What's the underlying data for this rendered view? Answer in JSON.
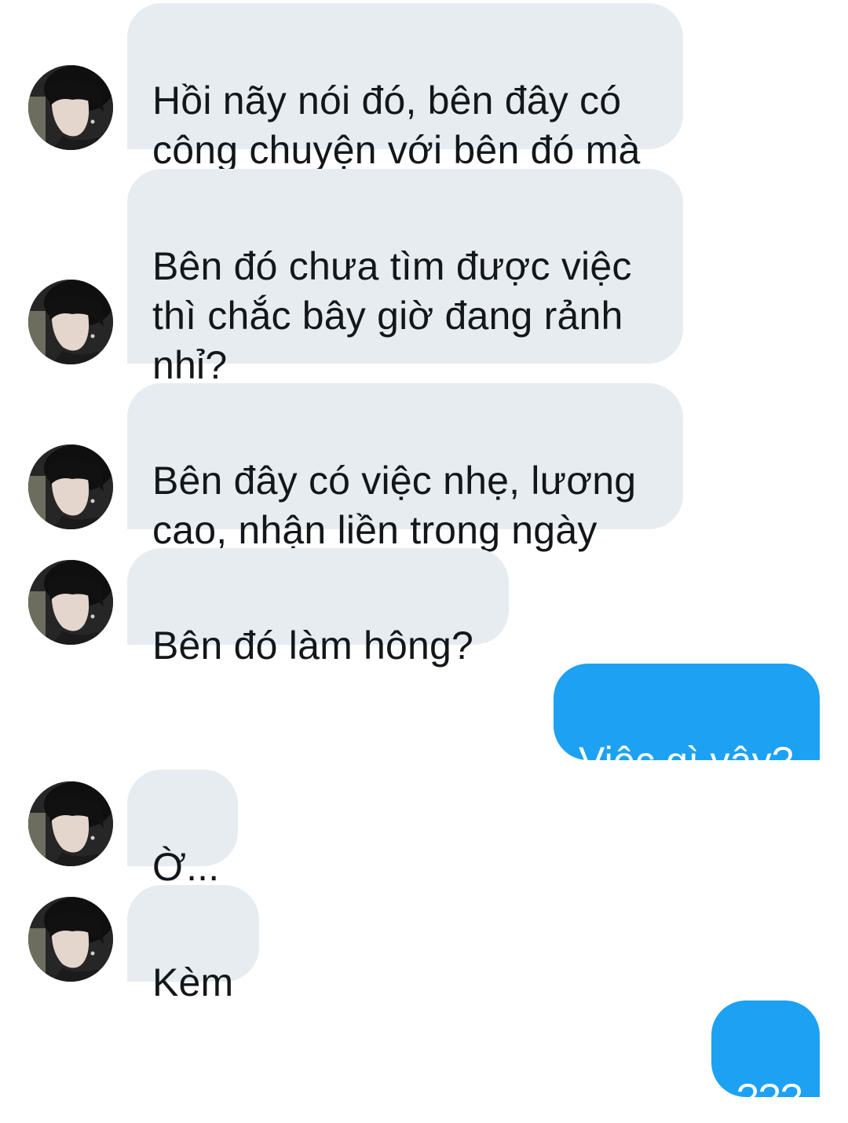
{
  "conversation": {
    "messages": [
      {
        "direction": "incoming",
        "text": "Hồi nãy nói đó, bên đây có\ncông chuyện với bên đó mà",
        "avatar_icon": "profile-photo-avatar"
      },
      {
        "direction": "incoming",
        "text": "Bên đó chưa tìm được việc\nthì chắc bây giờ đang rảnh\nnhỉ?",
        "avatar_icon": "profile-photo-avatar"
      },
      {
        "direction": "incoming",
        "text": "Bên đây có việc nhẹ, lương\ncao, nhận liền trong ngày",
        "avatar_icon": "profile-photo-avatar"
      },
      {
        "direction": "incoming",
        "text": "Bên đó làm hông?",
        "avatar_icon": "profile-photo-avatar"
      },
      {
        "direction": "outgoing",
        "text": "Việc gì vậy?"
      },
      {
        "direction": "incoming",
        "text": "Ờ...",
        "avatar_icon": "profile-photo-avatar"
      },
      {
        "direction": "incoming",
        "text": "Kèm",
        "avatar_icon": "profile-photo-avatar"
      },
      {
        "direction": "outgoing",
        "text": "???"
      }
    ]
  },
  "colors": {
    "incoming_bubble": "#e6ecf0",
    "outgoing_bubble": "#1da1f2",
    "incoming_text": "#14171a",
    "outgoing_text": "#ffffff"
  }
}
